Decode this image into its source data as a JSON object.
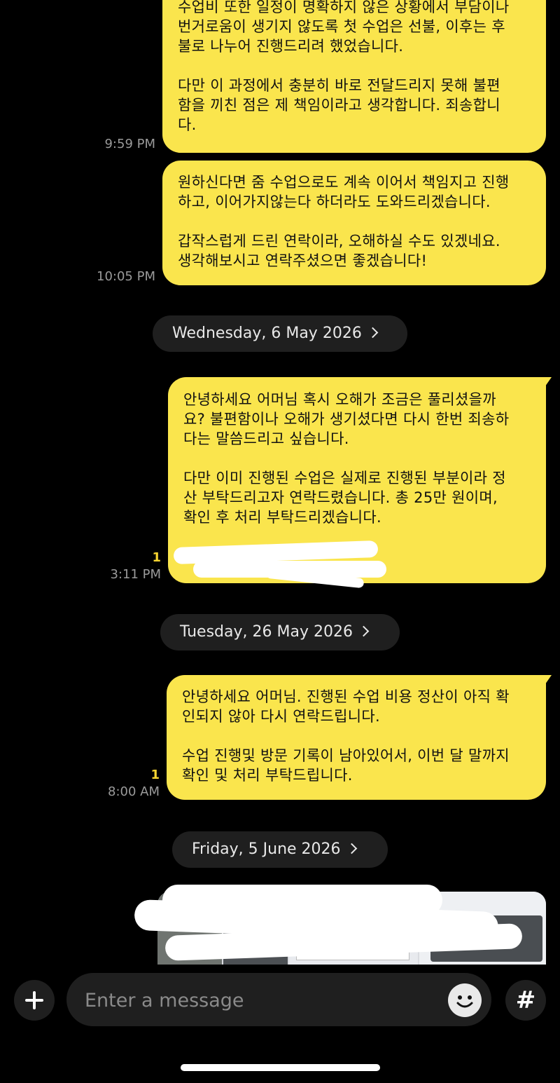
{
  "messages": [
    {
      "time": "9:59 PM",
      "paragraphs": [
        "수업비 또한 일정이 명확하지 않은 상황에서 부담이나\n번거로움이 생기지 않도록 첫 수업은 선불, 이후는 후\n불로 나누어 진행드리려 했었습니다.",
        "다만 이 과정에서 충분히 바로 전달드리지 못해 불편\n함을 끼친 점은 제 책임이라고 생각합니다. 죄송합니\n다."
      ]
    },
    {
      "time": "10:05 PM",
      "paragraphs": [
        "원하신다면 줌 수업으로도 계속 이어서 책임지고 진행\n하고, 이어가지않는다 하더라도 도와드리겠습니다.",
        "갑작스럽게 드린 연락이라, 오해하실 수도 있겠네요.\n생각해보시고 연락주셨으면 좋겠습니다!"
      ]
    },
    {
      "time": "3:11 PM",
      "unread": "1",
      "paragraphs": [
        "안녕하세요 어머님 혹시 오해가 조금은 풀리셨을까\n요? 불편함이나 오해가 생기셨다면 다시 한번 죄송하\n다는 말씀드리고 싶습니다.",
        "다만 이미 진행된 수업은 실제로 진행된 부분이라 정\n산 부탁드리고자 연락드렸습니다. 총 25만 원이며,\n확인 후 처리 부탁드리겠습니다."
      ]
    },
    {
      "time": "8:00 AM",
      "unread": "1",
      "paragraphs": [
        "안녕하세요 어머님. 진행된 수업 비용 정산이 아직 확\n인되지 않아 다시 연락드립니다.",
        "수업 진행및 방문 기록이 남아있어서, 이번 달 말까지\n확인 및 처리 부탁드립니다."
      ]
    }
  ],
  "dates": [
    "Wednesday, 6 May 2026",
    "Tuesday, 26 May 2026",
    "Friday, 5 June 2026"
  ],
  "composer": {
    "placeholder": "Enter a message",
    "plus_icon": "plus-icon",
    "emoji_icon": "emoji-icon",
    "hash_icon": "hash-icon",
    "hash_glyph": "#"
  },
  "colors": {
    "bubble": "#FAE54D",
    "background": "#000000",
    "unread": "#F7D531",
    "pill": "#1f1f1f"
  }
}
